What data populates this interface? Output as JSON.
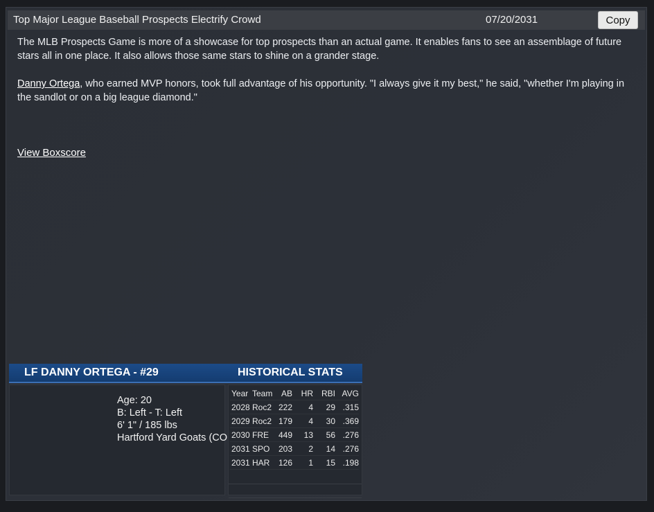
{
  "header": {
    "headline": "Top Major League Baseball Prospects Electrify Crowd",
    "date": "07/20/2031",
    "copy_label": "Copy"
  },
  "article": {
    "paragraph1": "The MLB Prospects Game is more of a showcase for top prospects than an actual game. It enables fans to see an assemblage of future stars all in one place. It also allows those same stars to shine on a grander stage.",
    "player_link": "Danny Ortega",
    "paragraph2_rest": ", who earned MVP honors, took full advantage of his opportunity. \"I always give it my best,\" he said, \"whether I'm playing in the sandlot or on a big league diamond.\"",
    "boxscore_link": "View Boxscore"
  },
  "player_card": {
    "title": "LF DANNY ORTEGA - #29",
    "historical_title": "HISTORICAL STATS",
    "age": "Age: 20",
    "bats_throws": "B: Left - T: Left",
    "size": "6' 1\"  / 185 lbs",
    "team": "Hartford Yard Goats (COL, AA)"
  },
  "stats": {
    "headers": [
      "Year",
      "Team",
      "AB",
      "HR",
      "RBI",
      "AVG"
    ],
    "rows": [
      [
        "2028",
        "Roc2",
        "222",
        "4",
        "29",
        ".315"
      ],
      [
        "2029",
        "Roc2",
        "179",
        "4",
        "30",
        ".369"
      ],
      [
        "2030",
        "FRE",
        "449",
        "13",
        "56",
        ".276"
      ],
      [
        "2031",
        "SPO",
        "203",
        "2",
        "14",
        ".276"
      ],
      [
        "2031",
        "HAR",
        "126",
        "1",
        "15",
        ".198"
      ]
    ]
  },
  "colors": {
    "card_bar": "#1c4b88",
    "background": "#2c3038"
  }
}
